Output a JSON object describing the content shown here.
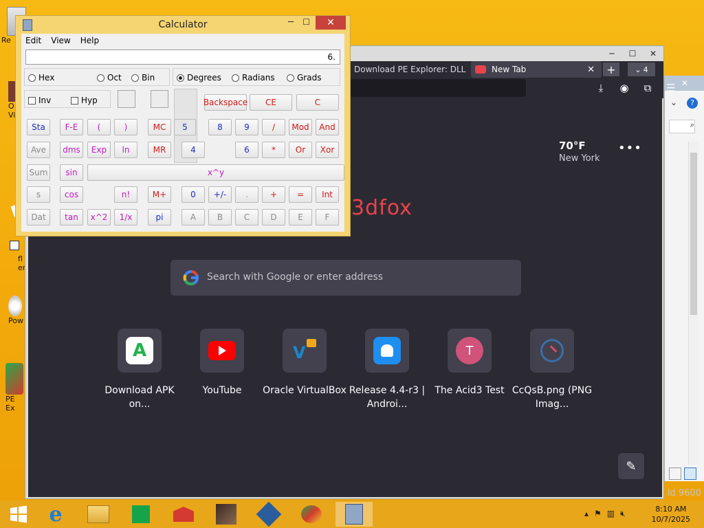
{
  "desktop": {
    "icons": [
      {
        "label": "Re"
      },
      {
        "label": "O\nVi"
      },
      {
        "label": "fl\nemu"
      },
      {
        "label": "Pow"
      },
      {
        "label": "PE Ex"
      }
    ]
  },
  "browser": {
    "tabs": [
      {
        "label": "Download PE Explorer: DLL"
      },
      {
        "label": "New Tab"
      }
    ],
    "tab_count": "4",
    "weather": {
      "temp": "70°F",
      "city": "New York"
    },
    "logo_text": "3dfox",
    "search_placeholder": "Search with Google or enter address",
    "shortcuts": [
      {
        "label": "Download APK on..."
      },
      {
        "label": "YouTube"
      },
      {
        "label": "Oracle VirtualBox"
      },
      {
        "label": "Release 4.4-r3 | Androi..."
      },
      {
        "label": "The Acid3 Test"
      },
      {
        "label": "CcQsB.png (PNG Imag..."
      }
    ],
    "acid3_letter": "T"
  },
  "calculator": {
    "title": "Calculator",
    "menu": [
      "Edit",
      "View",
      "Help"
    ],
    "display": "6.",
    "base_modes": [
      "Hex",
      "Oct",
      "Bin"
    ],
    "angle_modes": [
      "Degrees",
      "Radians",
      "Grads"
    ],
    "selected_angle": "Degrees",
    "checks": [
      "Inv",
      "Hyp"
    ],
    "buttons": {
      "backspace": "Backspace",
      "ce": "CE",
      "c": "C",
      "sta": "Sta",
      "ave": "Ave",
      "sum": "Sum",
      "s": "s",
      "dat": "Dat",
      "fe": "F-E",
      "dms": "dms",
      "sin": "sin",
      "cos": "cos",
      "tan": "tan",
      "lparen": "(",
      "exp": "Exp",
      "x2": "x^2",
      "rparen": ")",
      "ln": "ln",
      "nfact": "n!",
      "inv1x": "1/x",
      "xy": "x^y",
      "mc": "MC",
      "mr": "MR",
      "mplus": "M+",
      "pi": "pi",
      "d5": "5",
      "d4": "4",
      "d0": "0",
      "plusminus": "+/-",
      "d8": "8",
      "dot": ".",
      "B": "B",
      "d9": "9",
      "d6": "6",
      "plus": "+",
      "C2": "C",
      "div": "/",
      "mul": "*",
      "A": "A",
      "D": "D",
      "mod": "Mod",
      "or": "Or",
      "eq": "=",
      "E": "E",
      "and": "And",
      "xor": "Xor",
      "int": "Int",
      "F": "F"
    }
  },
  "taskbar": {
    "time": "8:10 AM",
    "date": "10/7/2025"
  },
  "watermark": "ld 9600"
}
